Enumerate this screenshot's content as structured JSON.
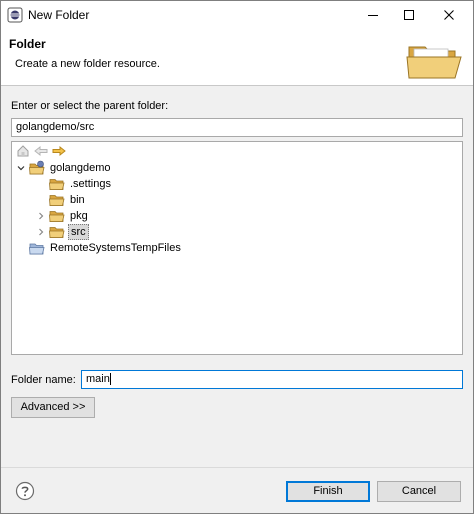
{
  "window": {
    "title": "New Folder"
  },
  "header": {
    "title": "Folder",
    "description": "Create a new folder resource."
  },
  "parent": {
    "label": "Enter or select the parent folder:",
    "value": "golangdemo/src"
  },
  "tree": {
    "items": [
      {
        "label": "golangdemo",
        "icon": "project-icon",
        "expanded": true
      },
      {
        "label": ".settings",
        "icon": "folder-icon"
      },
      {
        "label": "bin",
        "icon": "folder-icon"
      },
      {
        "label": "pkg",
        "icon": "folder-icon",
        "collapsed": true
      },
      {
        "label": "src",
        "icon": "folder-icon",
        "collapsed": true,
        "selected": true
      },
      {
        "label": "RemoteSystemsTempFiles",
        "icon": "project-icon"
      }
    ]
  },
  "folder_name": {
    "label": "Folder name:",
    "value": "main"
  },
  "buttons": {
    "advanced": "Advanced >>",
    "finish": "Finish",
    "cancel": "Cancel"
  },
  "colors": {
    "accent": "#0078d7",
    "folder": "#e8b84a"
  }
}
